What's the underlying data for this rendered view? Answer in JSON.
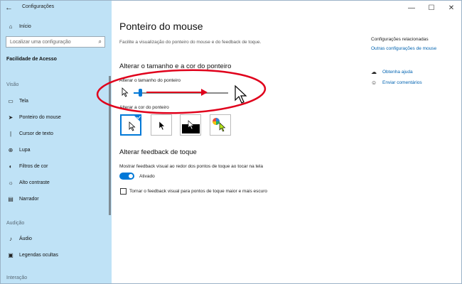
{
  "app": {
    "title": "Configurações"
  },
  "sidebar": {
    "home_label": "Início",
    "search_placeholder": "Localizar uma configuração",
    "section": "Facilidade de Acesso",
    "groups": [
      {
        "title": "Visão",
        "items": [
          {
            "label": "Tela",
            "icon": "monitor-icon"
          },
          {
            "label": "Ponteiro do mouse",
            "icon": "mouse-pointer-icon"
          },
          {
            "label": "Cursor de texto",
            "icon": "text-cursor-icon"
          },
          {
            "label": "Lupa",
            "icon": "magnifier-icon"
          },
          {
            "label": "Filtros de cor",
            "icon": "color-filter-icon"
          },
          {
            "label": "Alto contraste",
            "icon": "contrast-icon"
          },
          {
            "label": "Narrador",
            "icon": "narrator-icon"
          }
        ]
      },
      {
        "title": "Audição",
        "items": [
          {
            "label": "Áudio",
            "icon": "speaker-icon"
          },
          {
            "label": "Legendas ocultas",
            "icon": "captions-icon"
          }
        ]
      },
      {
        "title": "Interação",
        "items": []
      }
    ]
  },
  "main": {
    "title": "Ponteiro do mouse",
    "subtitle": "Facilite a visualização do ponteiro do mouse e do feedback de toque.",
    "size_color_section": "Alterar o tamanho e a cor do ponteiro",
    "size_label": "Alterar o tamanho do ponteiro",
    "pointer_size_value": 0.08,
    "color_label": "Alterar a cor do ponteiro",
    "color_options": [
      "white",
      "black",
      "inverted",
      "custom"
    ],
    "selected_color_option": "white",
    "touch_section": "Alterar feedback de toque",
    "touch_toggle_label": "Mostrar feedback visual ao redor dos pontos de toque ao tocar na tela",
    "touch_toggle_state": "Ativado",
    "checkbox_label": "Tornar o feedback visual para pontos de toque maior e mais escuro"
  },
  "related": {
    "title": "Configurações relacionadas",
    "link": "Outras configurações de mouse",
    "help": "Obtenha ajuda",
    "feedback": "Enviar comentários"
  },
  "colors": {
    "accent": "#0078d7",
    "sidebar_bg": "#bfe2f6",
    "annotation": "#e0001b"
  }
}
